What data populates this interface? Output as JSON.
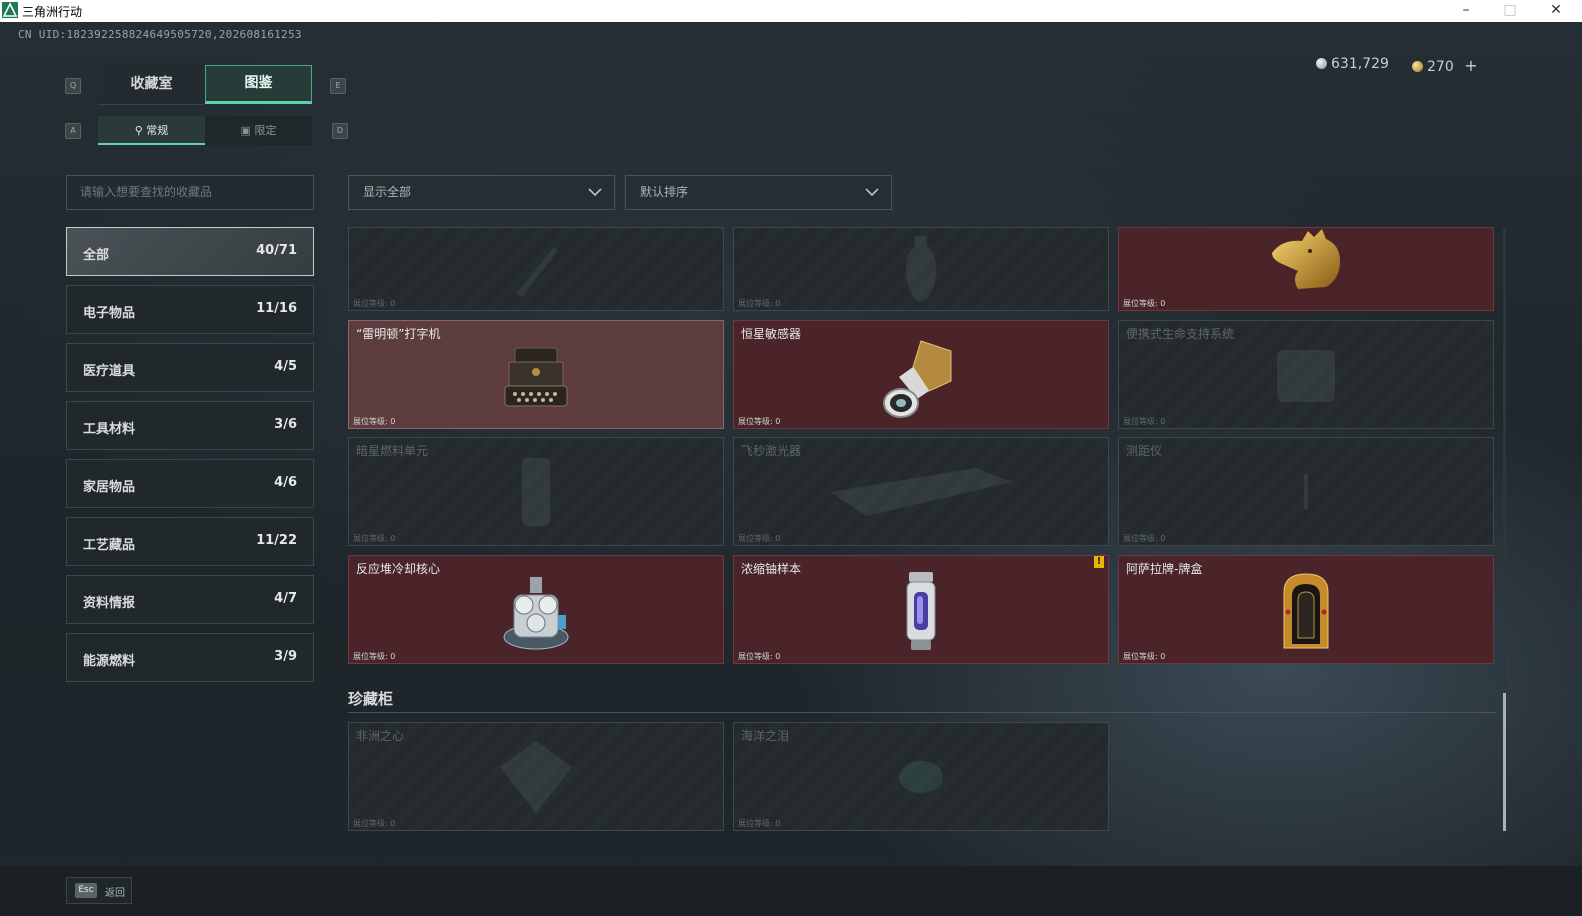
{
  "window": {
    "title": "三角洲行动"
  },
  "uid": "CN UID:1823922588246495057​20,202608161253",
  "top_tabs": {
    "left_key": "Q",
    "right_key": "E",
    "items": [
      {
        "label": "收藏室"
      },
      {
        "label": "图鉴"
      }
    ],
    "active": 1
  },
  "sub_tabs": {
    "left_key": "A",
    "right_key": "D",
    "items": [
      {
        "label": "常规"
      },
      {
        "label": "限定"
      }
    ],
    "active": 0
  },
  "currency": {
    "silver": "631,729",
    "gold": "270",
    "add": "+"
  },
  "search": {
    "placeholder": "请输入想要查找的收藏品"
  },
  "categories": [
    {
      "name": "全部",
      "count": "40/71"
    },
    {
      "name": "电子物品",
      "count": "11/16"
    },
    {
      "name": "医疗道具",
      "count": "4/5"
    },
    {
      "name": "工具材料",
      "count": "3/6"
    },
    {
      "name": "家居物品",
      "count": "4/6"
    },
    {
      "name": "工艺藏品",
      "count": "11/22"
    },
    {
      "name": "资料情报",
      "count": "4/7"
    },
    {
      "name": "能源燃料",
      "count": "3/9"
    }
  ],
  "filters": {
    "show": "显示全部",
    "sort": "默认排序"
  },
  "cards": [
    {
      "name": "",
      "level": "展位等级: 0",
      "state": "locked",
      "icon": "knife-icon"
    },
    {
      "name": "",
      "level": "展位等级: 0",
      "state": "locked",
      "icon": "vase-icon"
    },
    {
      "name": "",
      "level": "展位等级: 0",
      "state": "owned",
      "icon": "golden-head-statue-icon"
    },
    {
      "name": "“雷明顿”打字机",
      "level": "展位等级: 0",
      "state": "highlight",
      "icon": "typewriter-icon"
    },
    {
      "name": "恒星敏感器",
      "level": "展位等级: 0",
      "state": "owned",
      "icon": "star-sensor-icon"
    },
    {
      "name": "便携式生命支持系统",
      "level": "展位等级: 0",
      "state": "locked",
      "icon": "life-support-icon"
    },
    {
      "name": "暗星燃料单元",
      "level": "展位等级: 0",
      "state": "locked",
      "icon": "fuel-cell-icon"
    },
    {
      "name": "飞秒激光器",
      "level": "展位等级: 0",
      "state": "locked",
      "icon": "laser-icon"
    },
    {
      "name": "测距仪",
      "level": "展位等级: 0",
      "state": "locked",
      "icon": "rangefinder-icon"
    },
    {
      "name": "反应堆冷却核心",
      "level": "展位等级: 0",
      "state": "owned",
      "icon": "reactor-core-icon"
    },
    {
      "name": "浓缩铀样本",
      "level": "展位等级: 0",
      "state": "owned",
      "icon": "uranium-sample-icon",
      "warning": "!"
    },
    {
      "name": "阿萨拉牌-牌盒",
      "level": "展位等级: 0",
      "state": "owned",
      "icon": "card-box-icon"
    }
  ],
  "section": {
    "title": "珍藏柜"
  },
  "treasure_cards": [
    {
      "name": "非洲之心",
      "level": "展位等级: 0",
      "state": "locked",
      "icon": "diamond-icon"
    },
    {
      "name": "海洋之泪",
      "level": "展位等级: 0",
      "state": "locked",
      "icon": "gem-icon"
    }
  ],
  "footer": {
    "esc_key": "Esc",
    "back": "返回"
  },
  "colors": {
    "accent": "#5cd3a9",
    "owned": "#4a2428",
    "warning": "#e6b800"
  }
}
